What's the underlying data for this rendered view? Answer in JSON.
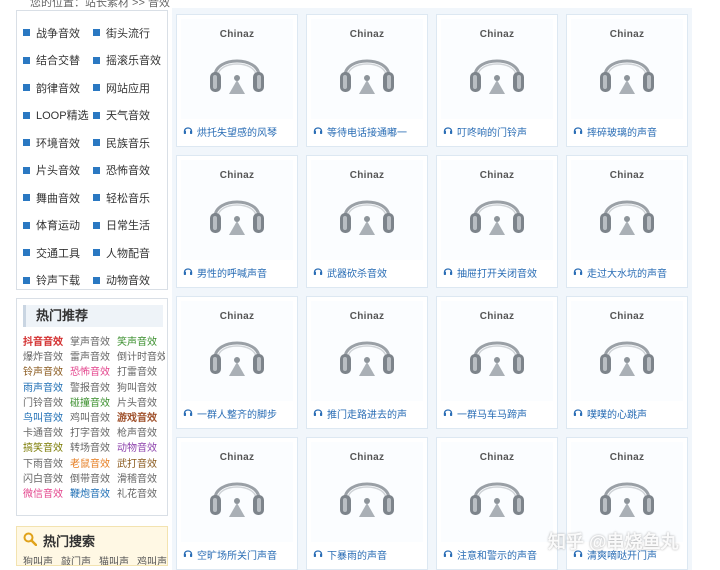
{
  "breadcrumb": {
    "text": "您的位置：站长素材 >> 音效"
  },
  "categories": [
    "战争音效",
    "街头流行",
    "结合交替",
    "摇滚乐音效",
    "韵律音效",
    "网站应用",
    "LOOP精选",
    "天气音效",
    "环境音效",
    "民族音乐",
    "片头音效",
    "恐怖音效",
    "舞曲音效",
    "轻松音乐",
    "体育运动",
    "日常生活",
    "交通工具",
    "人物配音",
    "铃声下载",
    "动物音效"
  ],
  "hot_recommend": {
    "title": "热门推荐",
    "tags": [
      {
        "text": "抖音音效",
        "style": "red"
      },
      {
        "text": "掌声音效",
        "style": "plain"
      },
      {
        "text": "笑声音效",
        "style": "green"
      },
      {
        "text": "爆炸音效",
        "style": "plain"
      },
      {
        "text": "雷声音效",
        "style": "plain"
      },
      {
        "text": "倒计时音效",
        "style": "plain"
      },
      {
        "text": "铃声音效",
        "style": "brown"
      },
      {
        "text": "恐怖音效",
        "style": "pink"
      },
      {
        "text": "打雷音效",
        "style": "plain"
      },
      {
        "text": "雨声音效",
        "style": "blue"
      },
      {
        "text": "警报音效",
        "style": "plain"
      },
      {
        "text": "狗叫音效",
        "style": "plain"
      },
      {
        "text": "门铃音效",
        "style": "plain"
      },
      {
        "text": "碰撞音效",
        "style": "green"
      },
      {
        "text": "片头音效",
        "style": "plain"
      },
      {
        "text": "鸟叫音效",
        "style": "blue"
      },
      {
        "text": "鸡叫音效",
        "style": "plain"
      },
      {
        "text": "游戏音效",
        "style": "brown-bold"
      },
      {
        "text": "卡通音效",
        "style": "plain"
      },
      {
        "text": "打字音效",
        "style": "plain"
      },
      {
        "text": "枪声音效",
        "style": "plain"
      },
      {
        "text": "搞笑音效",
        "style": "olive"
      },
      {
        "text": "转场音效",
        "style": "plain"
      },
      {
        "text": "动物音效",
        "style": "purple"
      },
      {
        "text": "下雨音效",
        "style": "plain"
      },
      {
        "text": "老鼠音效",
        "style": "orange"
      },
      {
        "text": "武打音效",
        "style": "brown"
      },
      {
        "text": "闪白音效",
        "style": "plain"
      },
      {
        "text": "倒带音效",
        "style": "plain"
      },
      {
        "text": "滑稽音效",
        "style": "plain"
      },
      {
        "text": "微信音效",
        "style": "pink"
      },
      {
        "text": "鞭炮音效",
        "style": "blue"
      },
      {
        "text": "礼花音效",
        "style": "plain"
      }
    ]
  },
  "hot_search": {
    "title": "热门搜索",
    "words": [
      "狗叫声",
      "敲门声",
      "猫叫声",
      "鸡叫声"
    ]
  },
  "thumb_brand": "Chinaz",
  "icons": {
    "category": "square-bullet",
    "sound": "headphone-icon",
    "search": "magnifier-icon",
    "thumbnail": "headphones-illustration"
  },
  "sounds": [
    "烘托失望感的风琴",
    "等待电话接通嘟一",
    "叮咚响的门铃声",
    "摔碎玻璃的声音",
    "男性的呼喊声音",
    "武器砍杀音效",
    "抽屉打开关闭音效",
    "走过大水坑的声音",
    "一群人整齐的脚步",
    "推门走路进去的声",
    "一群马车马蹄声",
    "噗噗的心跳声",
    "空旷场所关门声音",
    "下暴雨的声音",
    "注意和警示的声音",
    "清爽嘀哒开门声"
  ],
  "watermark": "知乎 @串烧鱼丸",
  "colors": {
    "accent": "#2a78c2",
    "link": "#2a6db5",
    "hot_red": "#d32f2f",
    "panel_bg": "#f1f6fb"
  }
}
